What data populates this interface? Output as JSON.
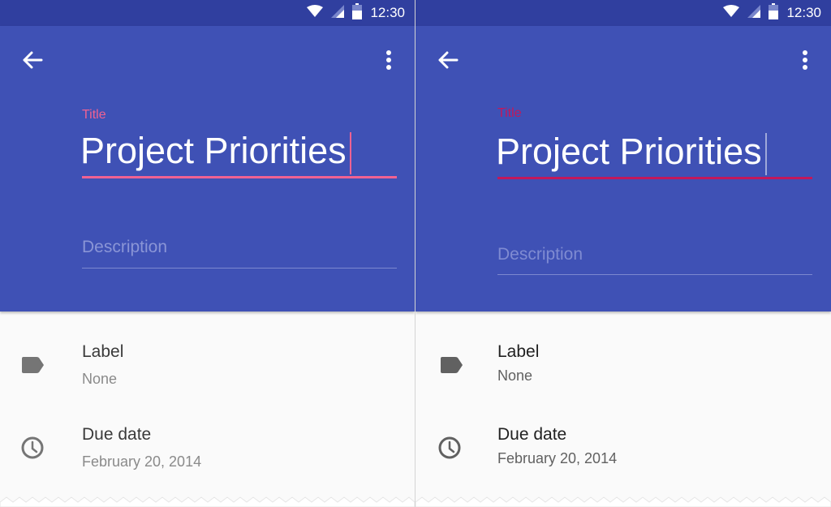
{
  "status": {
    "time": "12:30"
  },
  "left": {
    "title_label": "Title",
    "title_value": "Project Priorities",
    "description_placeholder": "Description",
    "accent": "#f06292",
    "label_heading": "Label",
    "label_value": "None",
    "due_heading": "Due date",
    "due_value": "February 20, 2014"
  },
  "right": {
    "title_label": "Title",
    "title_value": "Project Priorities",
    "description_placeholder": "Description",
    "accent": "#c2185b",
    "label_heading": "Label",
    "label_value": "None",
    "due_heading": "Due date",
    "due_value": "February 20, 2014"
  },
  "icons": {
    "back": "arrow-back-icon",
    "more": "more-vert-icon",
    "label": "label-tag-icon",
    "due": "clock-icon",
    "wifi": "wifi-icon",
    "signal": "signal-icon",
    "battery": "battery-icon"
  },
  "colors": {
    "appbar": "#3f51b5",
    "statusbar": "#303f9f"
  }
}
